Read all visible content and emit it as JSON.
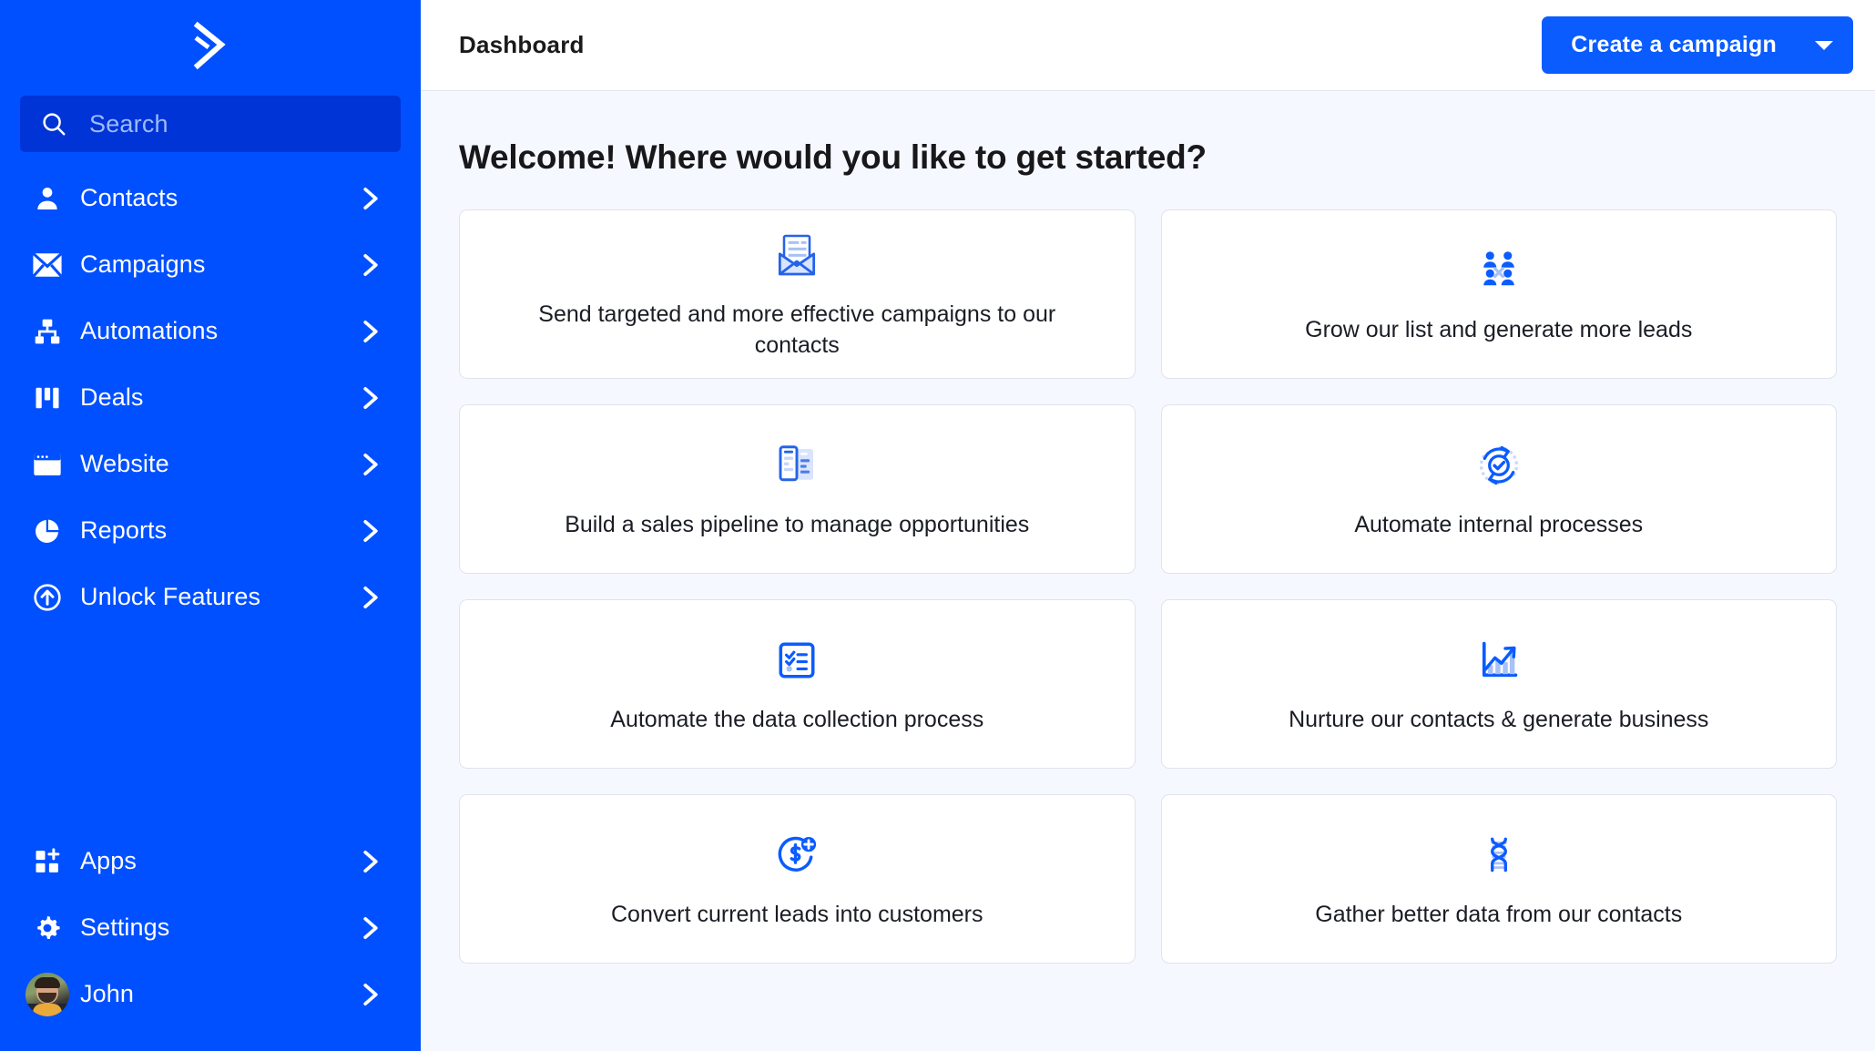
{
  "brand": {
    "logo_name": "activecampaign-chevron-logo",
    "sidebar_bg": "#0050ff",
    "search_bg": "#0034d6",
    "accent": "#0b5cff",
    "icon_light": "#a8c1f7",
    "canvas_bg": "#f6f8ff"
  },
  "sidebar": {
    "search": {
      "placeholder": "Search",
      "icon": "search-icon"
    },
    "items": [
      {
        "label": "Contacts",
        "icon": "person-icon",
        "chevron": "chevron-right-icon"
      },
      {
        "label": "Campaigns",
        "icon": "envelope-icon",
        "chevron": "chevron-right-icon"
      },
      {
        "label": "Automations",
        "icon": "hierarchy-icon",
        "chevron": "chevron-right-icon"
      },
      {
        "label": "Deals",
        "icon": "kanban-bars-icon",
        "chevron": "chevron-right-icon"
      },
      {
        "label": "Website",
        "icon": "browser-window-icon",
        "chevron": "chevron-right-icon"
      },
      {
        "label": "Reports",
        "icon": "pie-chart-icon",
        "chevron": "chevron-right-icon"
      },
      {
        "label": "Unlock Features",
        "icon": "arrow-up-circle-icon",
        "chevron": "chevron-right-icon"
      }
    ],
    "bottom_items": [
      {
        "label": "Apps",
        "icon": "apps-grid-plus-icon",
        "chevron": "chevron-right-icon"
      },
      {
        "label": "Settings",
        "icon": "gear-icon",
        "chevron": "chevron-right-icon"
      },
      {
        "label": "John",
        "icon": "user-avatar",
        "chevron": "chevron-right-icon"
      }
    ]
  },
  "topbar": {
    "title": "Dashboard",
    "cta_label": "Create a campaign",
    "cta_caret_icon": "caret-down-icon"
  },
  "main": {
    "heading": "Welcome! Where would you like to get started?",
    "cards": [
      {
        "label": "Send targeted and more effective campaigns to our contacts",
        "icon": "open-envelope-letter-icon"
      },
      {
        "label": "Grow our list and generate more leads",
        "icon": "people-group-icon"
      },
      {
        "label": "Build a sales pipeline to manage opportunities",
        "icon": "pipeline-cards-icon"
      },
      {
        "label": "Automate internal processes",
        "icon": "sync-check-icon"
      },
      {
        "label": "Automate the data collection process",
        "icon": "checklist-icon"
      },
      {
        "label": "Nurture our contacts & generate business",
        "icon": "growth-bar-chart-icon"
      },
      {
        "label": "Convert current leads into customers",
        "icon": "dollar-circle-plus-icon"
      },
      {
        "label": "Gather better data from our contacts",
        "icon": "dna-helix-icon"
      }
    ]
  }
}
